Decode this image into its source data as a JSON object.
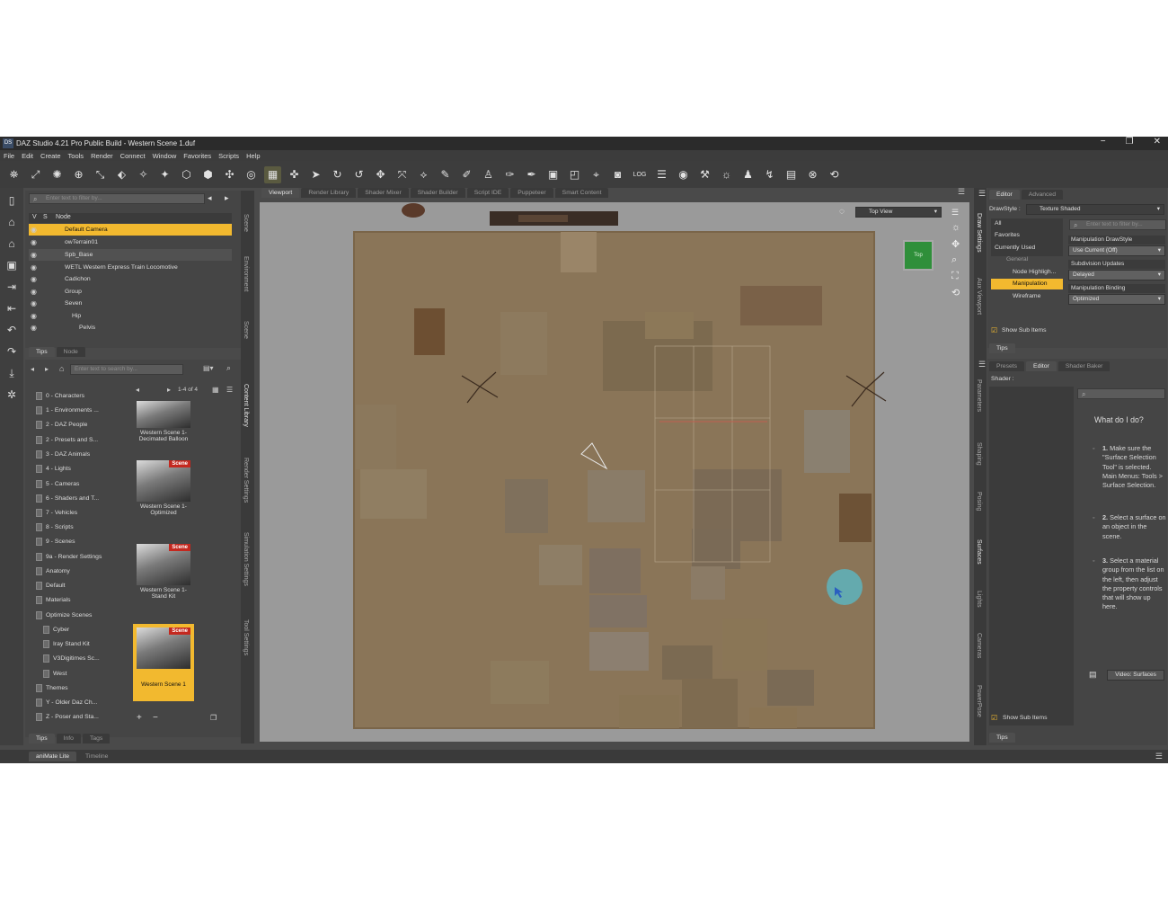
{
  "window": {
    "app_icon": "DS",
    "title": "DAZ Studio 4.21 Pro Public Build - Western Scene 1.duf",
    "minimize": "−",
    "maximize": "❐",
    "close": "✕"
  },
  "menu": [
    "File",
    "Edit",
    "Create",
    "Tools",
    "Render",
    "Connect",
    "Window",
    "Favorites",
    "Scripts",
    "Help"
  ],
  "toolbar": {
    "log_label": "LOG"
  },
  "scene": {
    "filter_placeholder": "Enter text to filter by...",
    "col_v": "V",
    "col_s": "S",
    "col_node": "Node",
    "nodes": [
      "Default Camera",
      "owTerrain01",
      "Spb_Base",
      "WETL Western Express Train Locomotive",
      "Cadichon",
      "Group",
      "Seven",
      "Hip",
      "Pelvis"
    ],
    "tabs": [
      "Tips",
      "Node"
    ]
  },
  "left_vtabs": [
    "Scene",
    "Environment",
    "Scene"
  ],
  "content": {
    "search_placeholder": "Enter text to search by...",
    "page_info": "1-4 of 4",
    "folders": [
      "0 - Characters",
      "1 - Environments ...",
      "2 - DAZ People",
      "2 - Presets and S...",
      "3 - DAZ Animals",
      "4 - Lights",
      "5 - Cameras",
      "6 - Shaders and T...",
      "7 - Vehicles",
      "8 - Scripts",
      "9 - Scenes",
      "9a - Render Settings",
      "Anatomy",
      "Default",
      "Materials",
      "Optimize Scenes",
      "Cyber",
      "Iray Stand Kit",
      "V3Digitimes Sc...",
      "West",
      "Themes",
      "Y - Older Daz Ch...",
      "Z - Poser and Sta..."
    ],
    "items": [
      {
        "name": "Western Scene 1-Decimated Balloon",
        "badge": ""
      },
      {
        "name": "Western Scene 1-Optimized",
        "badge": "Scene"
      },
      {
        "name": "Western Scene 1-Stand Kit",
        "badge": "Scene"
      },
      {
        "name": "Western Scene 1",
        "badge": "Scene"
      }
    ],
    "tabs": [
      "Tips",
      "Info",
      "Tags"
    ]
  },
  "mid_vtabs": [
    "Content Library",
    "Render Settings",
    "Simulation Settings",
    "Tool Settings"
  ],
  "viewport": {
    "tabs": [
      "Viewport",
      "Render Library",
      "Shader Mixer",
      "Shader Builder",
      "Script IDE",
      "Puppeteer",
      "Smart Content"
    ],
    "view_name": "Top View",
    "cube_label": "Top"
  },
  "draw_settings": {
    "tabs": [
      "Editor",
      "Advanced"
    ],
    "drawstyle_label": "DrawStyle :",
    "drawstyle_value": "Texture Shaded",
    "filter_placeholder": "Enter text to filter by...",
    "categories": [
      "All",
      "Favorites",
      "Currently Used"
    ],
    "tree": [
      "General",
      "Node Highligh...",
      "Manipulation",
      "Wireframe"
    ],
    "props": [
      {
        "label": "Manipulation DrawStyle",
        "value": "Use Current (Off)"
      },
      {
        "label": "Subdivision Updates",
        "value": "Delayed"
      },
      {
        "label": "Manipulation Binding",
        "value": "Optimized"
      }
    ],
    "show_sub_items": "Show Sub Items",
    "tips": "Tips"
  },
  "right_vtabs_top": [
    "Draw Settings",
    "Aux Viewport"
  ],
  "surfaces": {
    "tabs": [
      "Presets",
      "Editor",
      "Shader Baker"
    ],
    "shader_label": "Shader :",
    "help_title": "What do I do?",
    "steps": [
      {
        "num": "1.",
        "text": "Make sure the \"Surface Selection Tool\" is selected. Main Menus: Tools > Surface Selection."
      },
      {
        "num": "2.",
        "text": "Select a surface on an object in the scene."
      },
      {
        "num": "3.",
        "text": "Select a material group from the list on the left, then adjust the property controls that will show up here."
      }
    ],
    "video_label": "Video: Surfaces",
    "show_sub_items": "Show Sub Items",
    "tips": "Tips"
  },
  "right_vtabs_bottom": [
    "Parameters",
    "Shaping",
    "Posing",
    "Surfaces",
    "Lights",
    "Cameras",
    "PowerPose"
  ],
  "bottom_tabs": [
    "aniMate Lite",
    "Timeline"
  ]
}
